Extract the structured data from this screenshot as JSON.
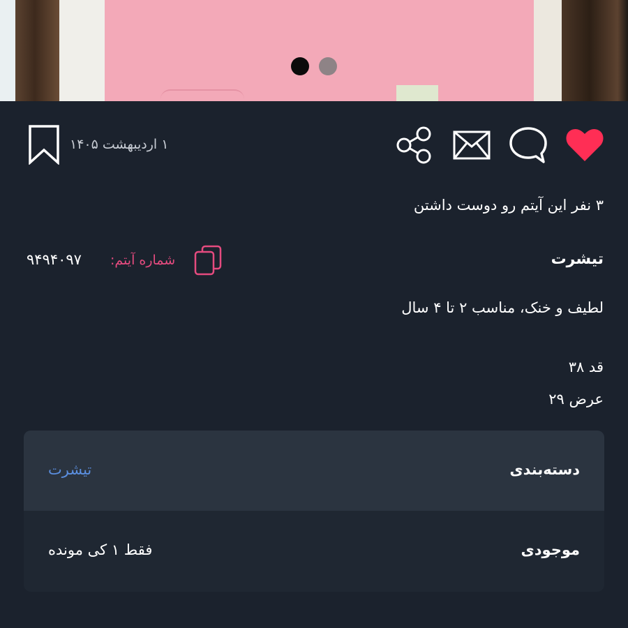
{
  "image_slider": {
    "total_images": 2,
    "current_index": 1
  },
  "actions": {
    "like_icon": "heart-filled-icon",
    "comment_icon": "speech-bubble-icon",
    "message_icon": "envelope-icon",
    "share_icon": "share-icon",
    "bookmark_icon": "bookmark-icon"
  },
  "date": "۱ اردیبهشت ۱۴۰۵",
  "likes_text": "۳ نفر این آیتم رو دوست داشتن",
  "item_number": {
    "label": "شماره آیتم:",
    "value": "۹۴۹۴۰۹۷",
    "icon": "copy-icon"
  },
  "title": "تیشرت",
  "description": "لطیف و خنک، مناسب ۲ تا ۴ سال",
  "dimensions": {
    "height": "قد ۳۸",
    "width": "عرض ۲۹"
  },
  "info": {
    "category": {
      "label": "دسته‌بندی",
      "value": "تیشرت"
    },
    "stock": {
      "label": "موجودی",
      "value": "فقط ۱ کی مونده"
    }
  },
  "colors": {
    "background": "#1b222d",
    "card_header": "#2b3440",
    "card_body": "#1f2732",
    "like_red": "#ff2e55",
    "accent_pink": "#e54b7f",
    "link_blue": "#5b8fe0"
  }
}
